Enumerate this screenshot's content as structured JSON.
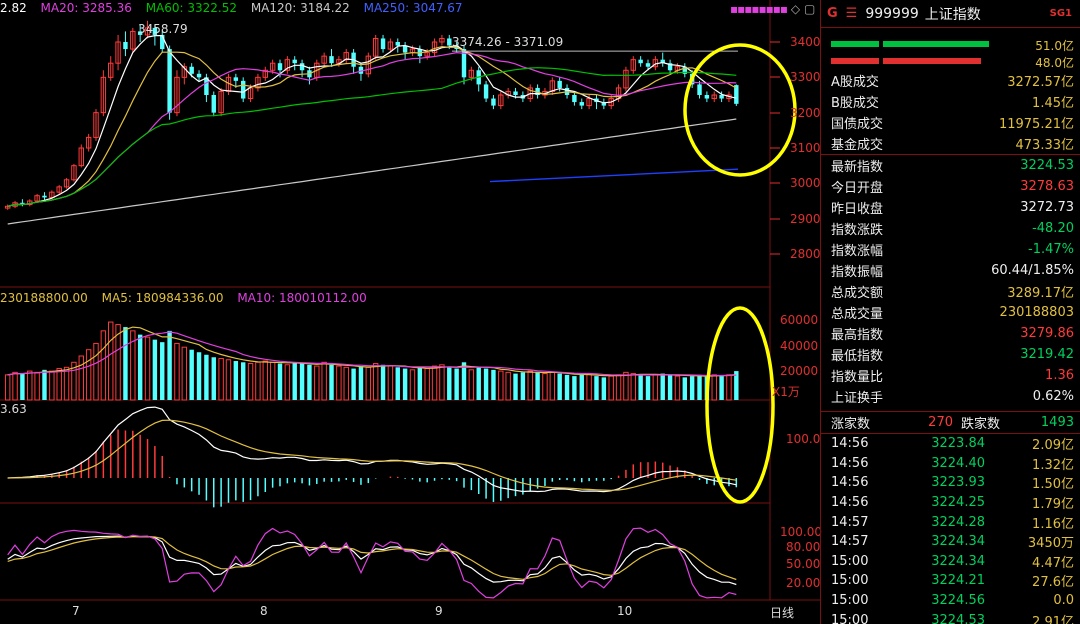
{
  "ma_legend": {
    "ma5": "2.82",
    "ma20": "MA20: 3285.36",
    "ma60": "MA60: 3322.52",
    "ma120": "MA120: 3184.22",
    "ma250": "MA250: 3047.67"
  },
  "annotations": {
    "high": "3458.79",
    "range": "3374.26 - 3371.09"
  },
  "price_axis": [
    "3400",
    "3300",
    "3200",
    "3100",
    "3000",
    "2900",
    "2800"
  ],
  "vol_legend": {
    "vol": "230188800.00",
    "ma5": "MA5: 180984336.00",
    "ma10": "MA10: 180010112.00"
  },
  "vol_axis": [
    "60000",
    "40000",
    "20000"
  ],
  "vol_unit": "X1万",
  "macd_legend": "3.63",
  "macd_axis": [
    "100.0"
  ],
  "kdj_axis": [
    "100.00",
    "80.00",
    "50.00",
    "20.00"
  ],
  "dates": [
    "7",
    "8",
    "9",
    "10"
  ],
  "period_button": "日线",
  "colors": {
    "bg": "#000000",
    "up": "#ff3b3b",
    "down": "#54ffff",
    "ma5": "#ffffff",
    "ma10": "#e0c040",
    "ma20": "#e040e0",
    "ma60": "#00c000",
    "ma120": "#c8c8c8",
    "ma250": "#2040ff",
    "highlight": "#ffff00"
  },
  "panel": {
    "g_label": "G",
    "menu_icon": "hamburger-icon",
    "code": "999999",
    "name": "上证指数",
    "sg": "SG1",
    "bar1_value": "51.0亿",
    "bar2_value": "48.0亿",
    "turnover": [
      {
        "label": "A股成交",
        "value": "3272.57亿"
      },
      {
        "label": "B股成交",
        "value": "1.45亿"
      },
      {
        "label": "国债成交",
        "value": "11975.21亿"
      },
      {
        "label": "基金成交",
        "value": "473.33亿"
      }
    ],
    "stats": [
      {
        "label": "最新指数",
        "value": "3224.53",
        "color": "c-grn"
      },
      {
        "label": "今日开盘",
        "value": "3278.63",
        "color": "c-red"
      },
      {
        "label": "昨日收盘",
        "value": "3272.73",
        "color": "c-wht"
      },
      {
        "label": "指数涨跌",
        "value": "-48.20",
        "color": "c-grn"
      },
      {
        "label": "指数涨幅",
        "value": "-1.47%",
        "color": "c-grn"
      },
      {
        "label": "指数振幅",
        "value": "60.44/1.85%",
        "color": "c-wht"
      },
      {
        "label": "总成交额",
        "value": "3289.17亿",
        "color": "c-yel"
      },
      {
        "label": "总成交量",
        "value": "230188803",
        "color": "c-yel"
      },
      {
        "label": "最高指数",
        "value": "3279.86",
        "color": "c-red"
      },
      {
        "label": "最低指数",
        "value": "3219.42",
        "color": "c-grn"
      },
      {
        "label": "指数量比",
        "value": "1.36",
        "color": "c-red"
      },
      {
        "label": "上证换手",
        "value": "0.62%",
        "color": "c-wht"
      }
    ],
    "up_label": "涨家数",
    "up_count": "270",
    "down_label": "跌家数",
    "down_count": "1493",
    "ticks": [
      {
        "time": "14:56",
        "price": "3223.84",
        "amount": "2.09亿"
      },
      {
        "time": "14:56",
        "price": "3224.40",
        "amount": "1.32亿"
      },
      {
        "time": "14:56",
        "price": "3223.93",
        "amount": "1.50亿"
      },
      {
        "time": "14:56",
        "price": "3224.25",
        "amount": "1.79亿"
      },
      {
        "time": "14:57",
        "price": "3224.28",
        "amount": "1.16亿"
      },
      {
        "time": "14:57",
        "price": "3224.34",
        "amount": "3450万"
      },
      {
        "time": "15:00",
        "price": "3224.34",
        "amount": "4.47亿"
      },
      {
        "time": "15:00",
        "price": "3224.21",
        "amount": "27.6亿"
      },
      {
        "time": "15:00",
        "price": "3224.56",
        "amount": "0.0"
      },
      {
        "time": "15:00",
        "price": "3224.53",
        "amount": "2.91亿"
      }
    ]
  },
  "chart_data": {
    "type": "candlestick",
    "price_range": [
      2800,
      3400
    ],
    "candles": [
      [
        2930,
        2935,
        2925,
        2940
      ],
      [
        2935,
        2945,
        2930,
        2950
      ],
      [
        2945,
        2940,
        2935,
        2955
      ],
      [
        2940,
        2950,
        2935,
        2955
      ],
      [
        2950,
        2965,
        2945,
        2970
      ],
      [
        2965,
        2960,
        2950,
        2975
      ],
      [
        2960,
        2975,
        2955,
        2980
      ],
      [
        2975,
        2990,
        2970,
        2995
      ],
      [
        2990,
        3010,
        2985,
        3015
      ],
      [
        3010,
        3050,
        3005,
        3055
      ],
      [
        3050,
        3100,
        3045,
        3110
      ],
      [
        3100,
        3130,
        3090,
        3140
      ],
      [
        3130,
        3200,
        3120,
        3210
      ],
      [
        3200,
        3300,
        3190,
        3320
      ],
      [
        3300,
        3340,
        3290,
        3360
      ],
      [
        3340,
        3400,
        3320,
        3420
      ],
      [
        3400,
        3380,
        3360,
        3430
      ],
      [
        3380,
        3430,
        3370,
        3440
      ],
      [
        3430,
        3420,
        3400,
        3450
      ],
      [
        3420,
        3440,
        3410,
        3460
      ],
      [
        3440,
        3420,
        3390,
        3450
      ],
      [
        3420,
        3380,
        3370,
        3430
      ],
      [
        3380,
        3200,
        3180,
        3390
      ],
      [
        3200,
        3300,
        3190,
        3320
      ],
      [
        3300,
        3330,
        3280,
        3340
      ],
      [
        3330,
        3310,
        3300,
        3340
      ],
      [
        3310,
        3300,
        3290,
        3320
      ],
      [
        3300,
        3250,
        3230,
        3310
      ],
      [
        3250,
        3200,
        3190,
        3260
      ],
      [
        3200,
        3260,
        3190,
        3270
      ],
      [
        3260,
        3300,
        3250,
        3310
      ],
      [
        3300,
        3290,
        3270,
        3310
      ],
      [
        3290,
        3240,
        3230,
        3300
      ],
      [
        3240,
        3270,
        3230,
        3280
      ],
      [
        3270,
        3300,
        3260,
        3310
      ],
      [
        3300,
        3320,
        3290,
        3330
      ],
      [
        3320,
        3340,
        3310,
        3350
      ],
      [
        3340,
        3320,
        3300,
        3350
      ],
      [
        3320,
        3350,
        3310,
        3360
      ],
      [
        3350,
        3340,
        3320,
        3360
      ],
      [
        3340,
        3320,
        3300,
        3350
      ],
      [
        3320,
        3300,
        3280,
        3330
      ],
      [
        3300,
        3340,
        3290,
        3350
      ],
      [
        3340,
        3360,
        3330,
        3370
      ],
      [
        3360,
        3340,
        3330,
        3380
      ],
      [
        3340,
        3350,
        3330,
        3360
      ],
      [
        3350,
        3370,
        3340,
        3380
      ],
      [
        3370,
        3330,
        3310,
        3380
      ],
      [
        3330,
        3310,
        3290,
        3340
      ],
      [
        3310,
        3360,
        3300,
        3370
      ],
      [
        3360,
        3410,
        3350,
        3420
      ],
      [
        3410,
        3380,
        3370,
        3420
      ],
      [
        3380,
        3400,
        3370,
        3410
      ],
      [
        3400,
        3390,
        3370,
        3410
      ],
      [
        3390,
        3370,
        3350,
        3400
      ],
      [
        3370,
        3380,
        3360,
        3390
      ],
      [
        3380,
        3360,
        3340,
        3390
      ],
      [
        3360,
        3370,
        3350,
        3380
      ],
      [
        3370,
        3400,
        3360,
        3410
      ],
      [
        3400,
        3410,
        3390,
        3420
      ],
      [
        3410,
        3390,
        3380,
        3420
      ],
      [
        3390,
        3380,
        3370,
        3400
      ],
      [
        3380,
        3300,
        3280,
        3390
      ],
      [
        3300,
        3320,
        3290,
        3330
      ],
      [
        3320,
        3280,
        3260,
        3330
      ],
      [
        3280,
        3240,
        3230,
        3290
      ],
      [
        3240,
        3220,
        3210,
        3250
      ],
      [
        3220,
        3250,
        3210,
        3260
      ],
      [
        3250,
        3260,
        3240,
        3270
      ],
      [
        3260,
        3250,
        3240,
        3270
      ],
      [
        3250,
        3240,
        3230,
        3260
      ],
      [
        3240,
        3270,
        3230,
        3280
      ],
      [
        3270,
        3250,
        3240,
        3280
      ],
      [
        3250,
        3260,
        3240,
        3270
      ],
      [
        3260,
        3290,
        3250,
        3300
      ],
      [
        3290,
        3270,
        3260,
        3300
      ],
      [
        3270,
        3250,
        3240,
        3280
      ],
      [
        3250,
        3230,
        3220,
        3260
      ],
      [
        3230,
        3220,
        3210,
        3240
      ],
      [
        3220,
        3240,
        3210,
        3250
      ],
      [
        3240,
        3230,
        3210,
        3250
      ],
      [
        3230,
        3220,
        3210,
        3240
      ],
      [
        3220,
        3240,
        3210,
        3250
      ],
      [
        3240,
        3270,
        3230,
        3280
      ],
      [
        3270,
        3320,
        3260,
        3330
      ],
      [
        3320,
        3350,
        3310,
        3360
      ],
      [
        3350,
        3340,
        3330,
        3360
      ],
      [
        3340,
        3330,
        3320,
        3350
      ],
      [
        3330,
        3350,
        3320,
        3360
      ],
      [
        3350,
        3340,
        3330,
        3370
      ],
      [
        3340,
        3320,
        3310,
        3350
      ],
      [
        3320,
        3330,
        3310,
        3340
      ],
      [
        3330,
        3310,
        3300,
        3340
      ],
      [
        3310,
        3280,
        3270,
        3320
      ],
      [
        3280,
        3250,
        3240,
        3290
      ],
      [
        3250,
        3240,
        3230,
        3260
      ],
      [
        3240,
        3250,
        3230,
        3260
      ],
      [
        3250,
        3240,
        3230,
        3260
      ],
      [
        3240,
        3250,
        3230,
        3260
      ],
      [
        3278,
        3225,
        3219,
        3280
      ]
    ],
    "volumes": [
      20,
      22,
      21,
      23,
      22,
      24,
      23,
      25,
      26,
      30,
      35,
      40,
      45,
      55,
      62,
      60,
      58,
      55,
      52,
      50,
      48,
      46,
      55,
      45,
      42,
      40,
      38,
      36,
      34,
      33,
      32,
      31,
      30,
      29,
      30,
      31,
      30,
      29,
      28,
      30,
      29,
      28,
      27,
      30,
      28,
      27,
      26,
      25,
      27,
      26,
      29,
      28,
      27,
      26,
      25,
      24,
      26,
      25,
      27,
      28,
      26,
      25,
      30,
      24,
      26,
      25,
      24,
      23,
      22,
      21,
      22,
      23,
      22,
      21,
      22,
      21,
      20,
      19,
      20,
      21,
      19,
      18,
      19,
      20,
      22,
      21,
      20,
      19,
      20,
      21,
      20,
      19,
      18,
      19,
      20,
      19,
      20,
      19,
      20,
      23
    ]
  }
}
